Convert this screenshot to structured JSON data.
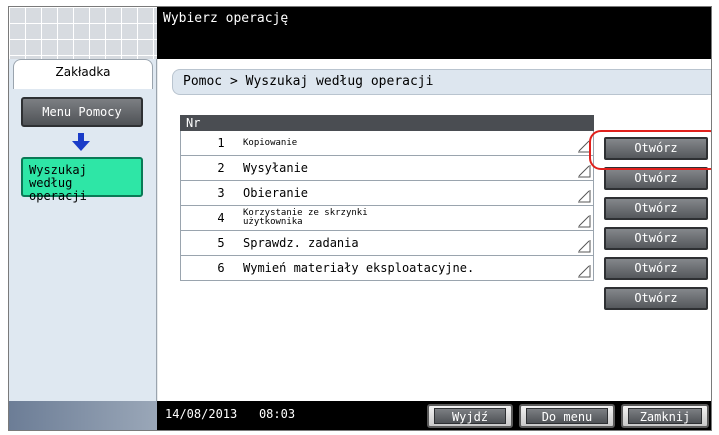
{
  "header": {
    "title": "Wybierz operację"
  },
  "sidebar": {
    "tab_label": "Zakładka",
    "menu_button": "Menu Pomocy",
    "search_button": "Wyszukaj według operacji"
  },
  "main": {
    "breadcrumb": "Pomoc > Wyszukaj według operacji",
    "list_header": "Nr",
    "open_label": "Otwórz",
    "rows": [
      {
        "num": "1",
        "label": "Kopiowanie"
      },
      {
        "num": "2",
        "label": "Wysyłanie"
      },
      {
        "num": "3",
        "label": "Obieranie"
      },
      {
        "num": "4",
        "label": "Korzystanie ze skrzynki użytkownika"
      },
      {
        "num": "5",
        "label": "Sprawdz. zadania"
      },
      {
        "num": "6",
        "label": "Wymień materiały eksploatacyjne."
      }
    ]
  },
  "footer": {
    "date": "14/08/2013",
    "time": "08:03",
    "exit_button": "Wyjdź",
    "menu_button": "Do menu",
    "close_button": "Zamknij"
  },
  "colors": {
    "highlight": "#e0201c",
    "active_button": "#2ee6a6",
    "arrow": "#1a3cc8"
  }
}
